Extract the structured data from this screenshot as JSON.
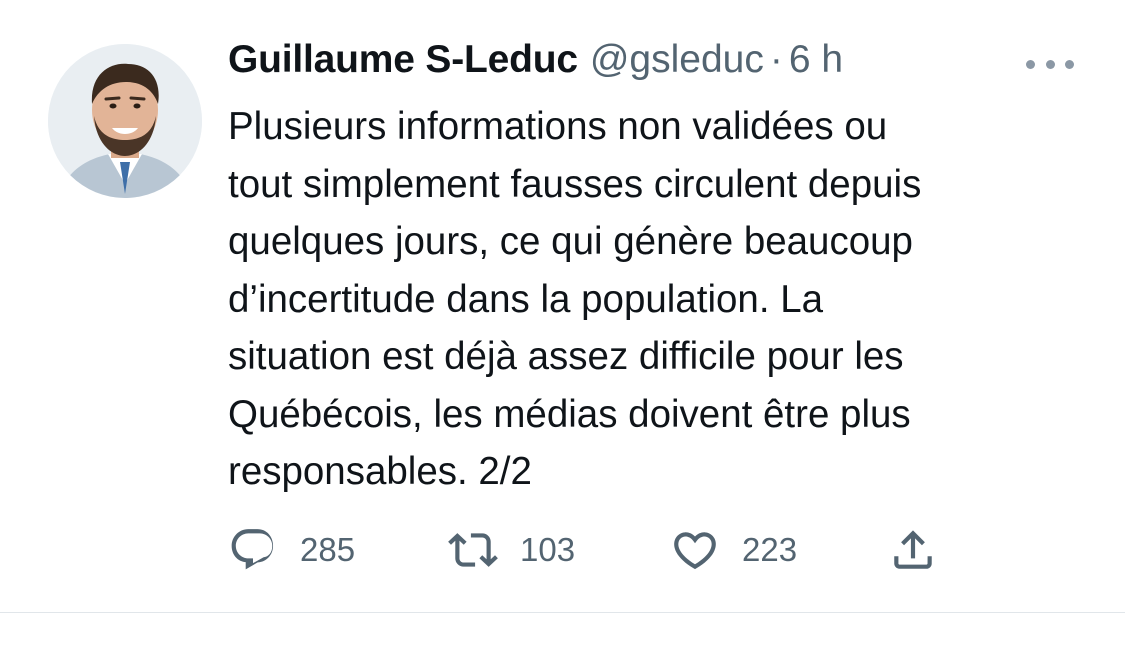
{
  "author": {
    "display_name": "Guillaume S-Leduc",
    "handle": "@gsleduc",
    "separator": "·",
    "time": "6 h"
  },
  "tweet": {
    "text": "Plusieurs informations non validées ou\ntout simplement fausses circulent depuis\nquelques jours, ce qui génère beaucoup\nd’incertitude dans la population. La\nsituation est déjà assez difficile pour les\nQuébécois, les médias doivent être plus\nresponsables. 2/2"
  },
  "actions": {
    "reply_count": "285",
    "retweet_count": "103",
    "like_count": "223"
  },
  "icons": {
    "more": "more-horizontal-icon",
    "reply": "reply-icon",
    "retweet": "retweet-icon",
    "like": "heart-icon",
    "share": "share-icon"
  },
  "colors": {
    "text_primary": "#0f1419",
    "text_secondary": "#536471",
    "divider": "#e1e6ea"
  }
}
